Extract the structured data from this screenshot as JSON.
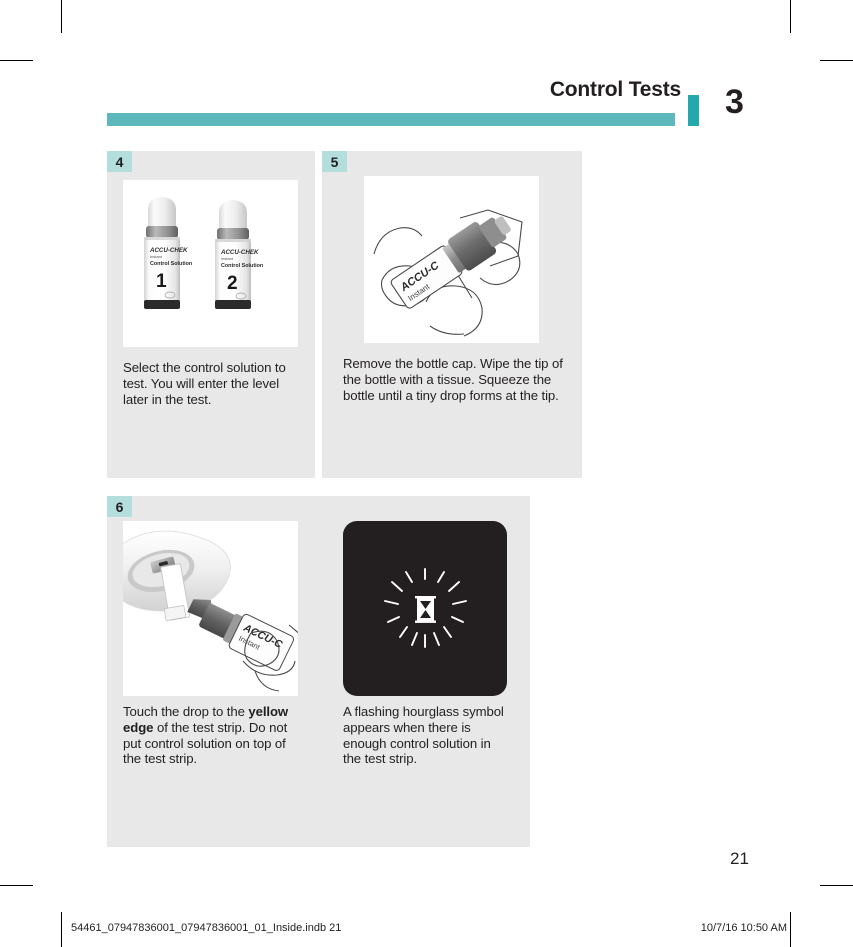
{
  "header": {
    "title": "Control Tests",
    "chapter": "3",
    "rule_color": "#5cb8bb",
    "accent_color": "#22a8ad"
  },
  "steps": [
    {
      "number": "4",
      "caption_prefix": "Select the control solution to test. You will enter the level later in the test.",
      "figure": {
        "alt": "two-control-solution-bottles",
        "bottle_1": {
          "brand": "ACCU-CHEK",
          "model": "Instant",
          "product": "Control Solution",
          "level": "1"
        },
        "bottle_2": {
          "brand": "ACCU-CHEK",
          "model": "Instant",
          "product": "Control Solution",
          "level": "2"
        }
      }
    },
    {
      "number": "5",
      "caption_prefix": "Remove the bottle cap. Wipe the tip of the bottle with a tissue. Squeeze the bottle until a tiny drop forms at the tip.",
      "figure": {
        "alt": "hand-squeezing-bottle-tip",
        "bottle_label_line1": "ACCU-C",
        "bottle_label_line2": "Instant"
      }
    },
    {
      "number": "6",
      "caption_a_part1": "Touch the drop to the ",
      "caption_a_bold": "yellow edge",
      "caption_a_part2": " of the test strip. Do not put control solution on top of the test strip.",
      "caption_b": "A flashing hourglass symbol appears when there is enough control solution in the test strip.",
      "figure_a": {
        "alt": "bottle-drop-to-test-strip-yellow-edge",
        "bottle_label_line1": "ACCU-C",
        "bottle_label_line2": "Instant"
      },
      "figure_b": {
        "alt": "meter-display-flashing-hourglass",
        "screen_color": "#231f20",
        "symbol_color": "#ffffff"
      }
    }
  ],
  "page_number": "21",
  "footer": {
    "left": "54461_07947836001_07947836001_01_Inside.indb   21",
    "right": "10/7/16   10:50 AM"
  },
  "badge_color": "#b3dedc",
  "panel_bg": "#e8e8e8"
}
